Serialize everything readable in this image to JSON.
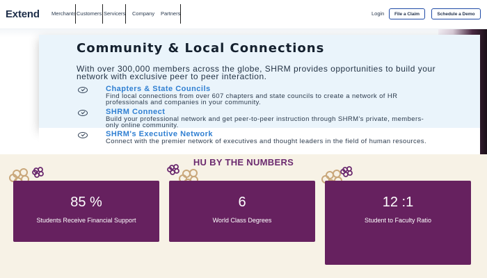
{
  "header": {
    "logo": "Extend",
    "nav": [
      "Merchants",
      "Customers",
      "Servicers",
      "Company",
      "Partners"
    ],
    "login": "Login",
    "file_claim": "File a Claim",
    "schedule_demo": "Schedule a Demo"
  },
  "hero": {
    "title": "Community & Local Connections",
    "intro": "With over 300,000 members across the globe, SHRM provides opportunities to build your network with exclusive peer to peer interaction.",
    "items": [
      {
        "title": "Chapters & State Councils",
        "text": "Find local connections from over 607 chapters and state councils to create a network of HR professionals and companies in your community."
      },
      {
        "title": "SHRM Connect",
        "text": "Build your professional network and get peer-to-peer instruction through SHRM's private, members-only online community."
      },
      {
        "title": "SHRM's Executive Network",
        "text": "Connect with the premier network of executives and thought leaders in the field of human resources."
      }
    ]
  },
  "numbers": {
    "title": "HU BY THE NUMBERS",
    "stats": [
      {
        "value": "85 %",
        "label": "Students Receive Financial Support"
      },
      {
        "value": "6",
        "label": "World Class Degrees"
      },
      {
        "value": "12 :1",
        "label": "Student to Faculty Ratio"
      }
    ]
  },
  "colors": {
    "accent_purple": "#66215f",
    "cream": "#f7f2e6",
    "link_blue": "#2f7fd2",
    "button_border": "#1f4aa6"
  }
}
